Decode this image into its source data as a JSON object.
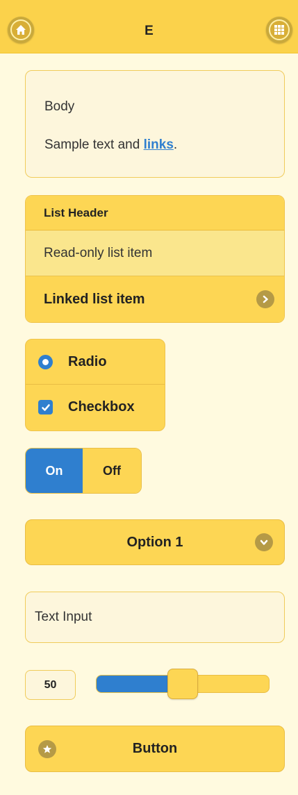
{
  "header": {
    "title": "E",
    "left_icon": "home-icon",
    "right_icon": "grid-icon"
  },
  "body_card": {
    "heading": "Body",
    "text_before_link": "Sample text and ",
    "link_text": "links",
    "text_after_link": "."
  },
  "list": {
    "header": "List Header",
    "readonly_item": "Read-only list item",
    "linked_item": "Linked list item",
    "linked_icon": "chevron-right-icon"
  },
  "choices": {
    "radio_label": "Radio",
    "checkbox_label": "Checkbox"
  },
  "toggle": {
    "on_label": "On",
    "off_label": "Off"
  },
  "select": {
    "value": "Option 1",
    "icon": "chevron-down-icon"
  },
  "text_input": {
    "placeholder": "Text Input"
  },
  "slider": {
    "value": "50",
    "fraction": 0.5
  },
  "button": {
    "label": "Button",
    "icon": "star-icon"
  },
  "colors": {
    "accent_blue": "#2f7fcf",
    "yellow": "#fdd654",
    "background": "#fffadf"
  }
}
